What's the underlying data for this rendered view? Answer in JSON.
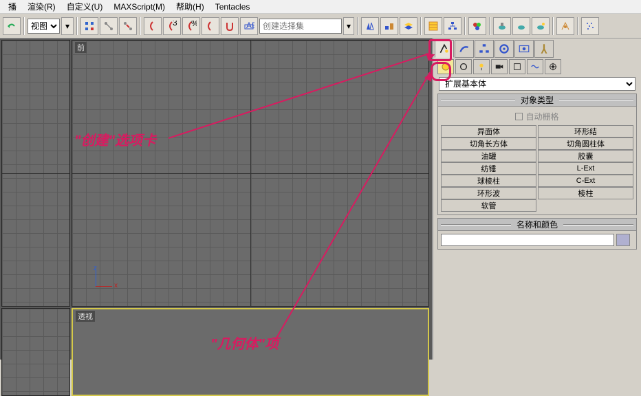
{
  "menu": {
    "render": "渲染(R)",
    "custom": "自定义(U)",
    "maxscript": "MAXScript(M)",
    "help": "帮助(H)",
    "tentacles": "Tentacles"
  },
  "view_dropdown": "视图",
  "selection_set": "创建选择集",
  "viewports": {
    "front": "前",
    "persp": "透视"
  },
  "cmdpanel": {
    "dropdown": "扩展基本体",
    "rollout_type": "对象类型",
    "autogrid": "自动栅格",
    "objs": [
      [
        "异面体",
        "环形结"
      ],
      [
        "切角长方体",
        "切角圆柱体"
      ],
      [
        "油罐",
        "胶囊"
      ],
      [
        "纺锤",
        "L-Ext"
      ],
      [
        "球棱柱",
        "C-Ext"
      ],
      [
        "环形波",
        "棱柱"
      ],
      [
        "软管",
        ""
      ]
    ],
    "rollout_name": "名称和颜色"
  },
  "annotations": {
    "create_tab": "\"创建\"选项卡",
    "geometry": "\"几何体\"项"
  }
}
